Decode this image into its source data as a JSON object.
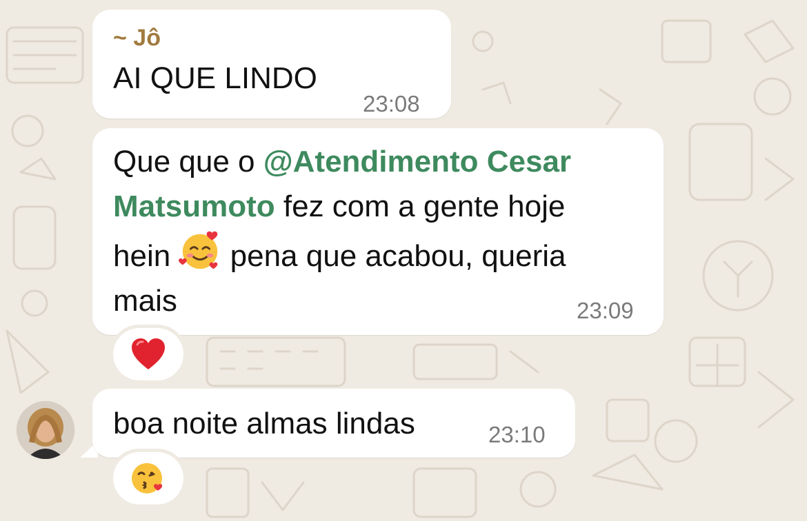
{
  "messages": [
    {
      "sender": "~ Jô",
      "text": "AI QUE LINDO",
      "time": "23:08"
    },
    {
      "text_before": "Que que o ",
      "mention": "@Atendimento Cesar Matsumoto",
      "mention_line1": "@Atendimento Cesar",
      "mention_line2": "Matsumoto",
      "text_line2_after": " fez com a gente hoje",
      "text_line3_before": "hein ",
      "emoji": "smiling-face-with-hearts",
      "text_line3_after": " pena que acabou, queria",
      "text_line4": "mais",
      "time": "23:09",
      "reaction": "red-heart"
    },
    {
      "text": "boa noite almas lindas",
      "time": "23:10",
      "reaction": "face-blowing-a-kiss"
    }
  ],
  "colors": {
    "background": "#efeae2",
    "bubble": "#ffffff",
    "sender_name": "#a17a3f",
    "mention": "#3e8a5e",
    "timestamp": "#7a7a7a"
  },
  "icons": [
    "avatar",
    "red-heart-icon",
    "smiling-face-with-hearts-icon",
    "face-blowing-a-kiss-icon"
  ]
}
